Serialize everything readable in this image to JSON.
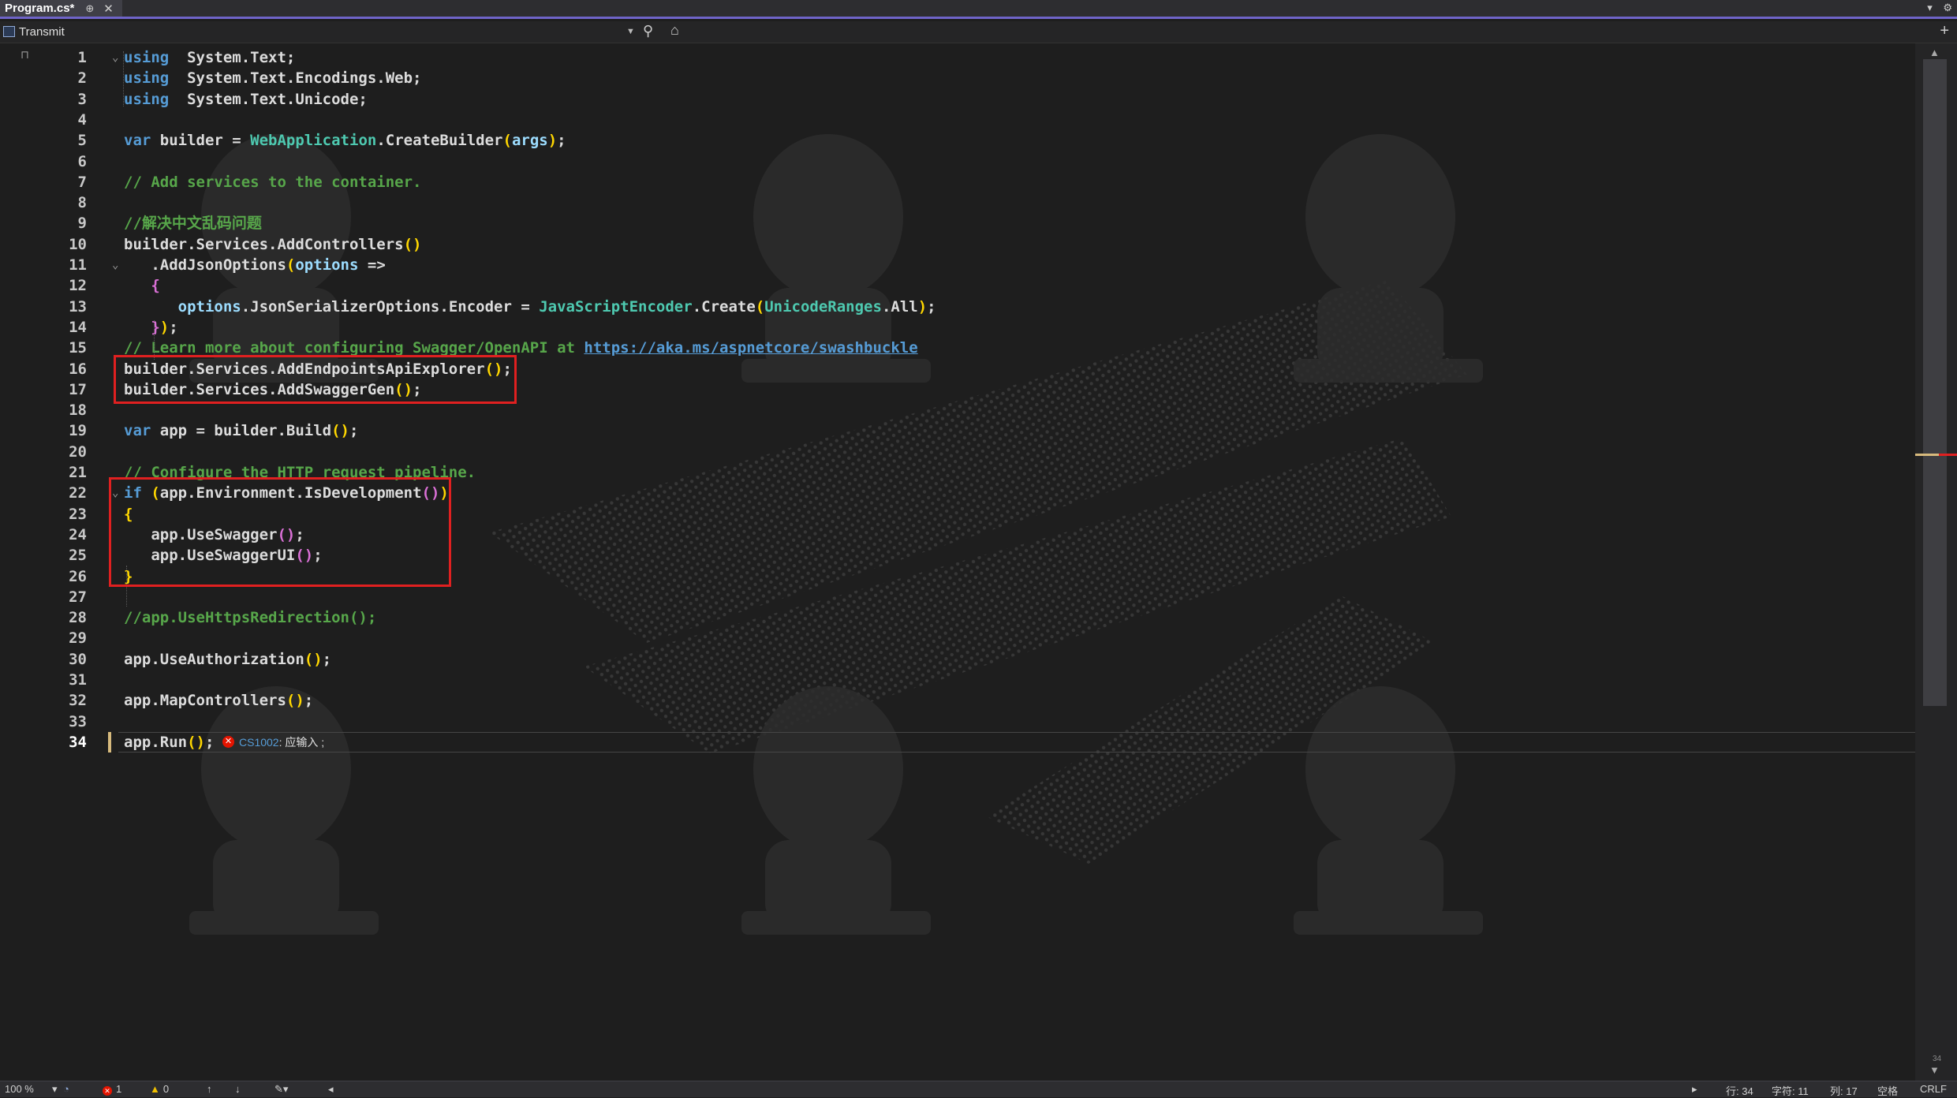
{
  "tab": {
    "title": "Program.cs*",
    "pin": "⊕",
    "close": "✕"
  },
  "nav": {
    "project": "Transmit"
  },
  "colors": {
    "accent": "#6f64c8",
    "highlight_box": "#e02020",
    "error": "#e51400"
  },
  "code": {
    "lines": [
      [
        [
          "kw",
          "using"
        ],
        [
          "",
          "  System.Text;"
        ]
      ],
      [
        [
          "kw",
          "using"
        ],
        [
          "",
          "  System.Text.Encodings.Web;"
        ]
      ],
      [
        [
          "kw",
          "using"
        ],
        [
          "",
          "  System.Text.Unicode;"
        ]
      ],
      [],
      [
        [
          "kw",
          "var"
        ],
        [
          "",
          " builder = "
        ],
        [
          "ty",
          "WebApplication"
        ],
        [
          "",
          ".CreateBuilder"
        ],
        [
          "b1",
          "("
        ],
        [
          "pr",
          "args"
        ],
        [
          "b1",
          ")"
        ],
        [
          "",
          ";"
        ]
      ],
      [],
      [
        [
          "cm",
          "// Add services to the container."
        ]
      ],
      [],
      [
        [
          "cm",
          "//解决中文乱码问题"
        ]
      ],
      [
        [
          "",
          "builder.Services.AddControllers"
        ],
        [
          "b1",
          "()"
        ]
      ],
      [
        [
          "",
          "   .AddJsonOptions"
        ],
        [
          "b1",
          "("
        ],
        [
          "pr",
          "options"
        ],
        [
          "",
          " =>"
        ]
      ],
      [
        [
          "",
          "   "
        ],
        [
          "b2",
          "{"
        ]
      ],
      [
        [
          "",
          "      "
        ],
        [
          "pr",
          "options"
        ],
        [
          "",
          ".JsonSerializerOptions.Encoder = "
        ],
        [
          "ty",
          "JavaScriptEncoder"
        ],
        [
          "",
          ".Create"
        ],
        [
          "b1",
          "("
        ],
        [
          "ty",
          "UnicodeRanges"
        ],
        [
          "",
          ".All"
        ],
        [
          "b1",
          ")"
        ],
        [
          "",
          ";"
        ]
      ],
      [
        [
          "",
          "   "
        ],
        [
          "b2",
          "}"
        ],
        [
          "b1",
          ")"
        ],
        [
          "",
          ";"
        ]
      ],
      [
        [
          "cm",
          "// Learn more about configuring Swagger/OpenAPI at "
        ],
        [
          "lk",
          "https://aka.ms/aspnetcore/swashbuckle"
        ]
      ],
      [
        [
          "",
          "builder.Services.AddEndpointsApiExplorer"
        ],
        [
          "b1",
          "()"
        ],
        [
          "",
          ";"
        ]
      ],
      [
        [
          "",
          "builder.Services.AddSwaggerGen"
        ],
        [
          "b1",
          "()"
        ],
        [
          "",
          ";"
        ]
      ],
      [],
      [
        [
          "kw",
          "var"
        ],
        [
          "",
          " app = builder.Build"
        ],
        [
          "b1",
          "()"
        ],
        [
          "",
          ";"
        ]
      ],
      [],
      [
        [
          "cm",
          "// Configure the HTTP request pipeline."
        ]
      ],
      [
        [
          "kw",
          "if"
        ],
        [
          "",
          " "
        ],
        [
          "b1",
          "("
        ],
        [
          "",
          "app.Environment.IsDevelopment"
        ],
        [
          "b2",
          "()"
        ],
        [
          "b1",
          ")"
        ]
      ],
      [
        [
          "b1",
          "{"
        ]
      ],
      [
        [
          "",
          "   app.UseSwagger"
        ],
        [
          "b2",
          "()"
        ],
        [
          "",
          ";"
        ]
      ],
      [
        [
          "",
          "   app.UseSwaggerUI"
        ],
        [
          "b2",
          "()"
        ],
        [
          "",
          ";"
        ]
      ],
      [
        [
          "b1",
          "}"
        ]
      ],
      [],
      [
        [
          "cm",
          "//app.UseHttpsRedirection();"
        ]
      ],
      [],
      [
        [
          "",
          "app.UseAuthorization"
        ],
        [
          "b1",
          "()"
        ],
        [
          "",
          ";"
        ]
      ],
      [],
      [
        [
          "",
          "app.MapControllers"
        ],
        [
          "b1",
          "()"
        ],
        [
          "",
          ";"
        ]
      ],
      [],
      [
        [
          "",
          "app.Run"
        ],
        [
          "b1",
          "()"
        ],
        [
          "",
          ";"
        ]
      ]
    ],
    "folds": [
      1,
      11,
      22
    ],
    "current_line": 34
  },
  "error_hint": {
    "code": "CS1002",
    "message": ": 应输入 ;"
  },
  "status": {
    "zoom": "100 %",
    "errors": "1",
    "warnings": "0",
    "line": "行: 34",
    "char": "字符: 11",
    "col": "列: 17",
    "whitespace": "空格",
    "eol": "CRLF"
  },
  "scrollbar": {
    "tiny_label": "34"
  }
}
